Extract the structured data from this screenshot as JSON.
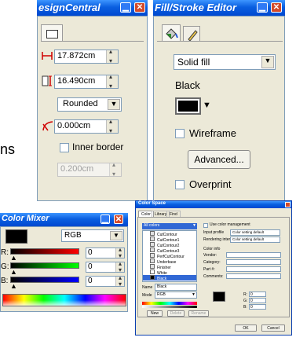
{
  "design_central": {
    "title": "esignCentral",
    "width_value": "17.872cm",
    "height_value": "16.490cm",
    "corner_style": "Rounded",
    "angle_value": "0.000cm",
    "inner_border_label": "Inner border",
    "border_width_value": "0.200cm"
  },
  "side_fragment": {
    "text": "ns"
  },
  "fill_stroke": {
    "title": "Fill/Stroke Editor",
    "fill_type": "Solid fill",
    "color_name": "Black",
    "wireframe_label": "Wireframe",
    "advanced_label": "Advanced...",
    "overprint_label": "Overprint"
  },
  "color_mixer": {
    "title": "Color Mixer",
    "model": "RGB",
    "channels": [
      {
        "label": "R:",
        "value": "0"
      },
      {
        "label": "G:",
        "value": "0"
      },
      {
        "label": "B:",
        "value": "0"
      }
    ]
  },
  "color_space": {
    "title": "Color Space",
    "tabs": [
      "Color",
      "Library",
      "Find"
    ],
    "list_header": "All colors",
    "list_items": [
      "CutContour",
      "CutContour1",
      "CutContour2",
      "CutContour3",
      "PerfCutContour",
      "Underbase",
      "Finisher",
      "White",
      "Black"
    ],
    "selected_item": "Black",
    "name_label": "Name",
    "name_value": "Black",
    "mode_label": "Mode",
    "mode_value": "RGB",
    "use_cm_label": "Use color management",
    "input_profile_label": "Input profile",
    "input_profile_value": "Color setting default",
    "rendering_intent_label": "Rendering intent",
    "rendering_intent_value": "Color setting default",
    "color_info_label": "Color info",
    "info_fields": [
      "Vendor:",
      "Category:",
      "Part #:",
      "Comments:"
    ],
    "rgb": [
      {
        "label": "R:",
        "value": "0"
      },
      {
        "label": "G:",
        "value": "0"
      },
      {
        "label": "B:",
        "value": "0"
      }
    ],
    "new_label": "New",
    "delete_label": "Delete",
    "rename_label": "Rename",
    "ok_label": "OK",
    "cancel_label": "Cancel"
  },
  "colors": {
    "xp_blue": "#0a5fe0",
    "panel_bg": "#ece9d8",
    "close_red": "#d34a2a",
    "field_border": "#7f9db9",
    "swatch": "#000000"
  }
}
